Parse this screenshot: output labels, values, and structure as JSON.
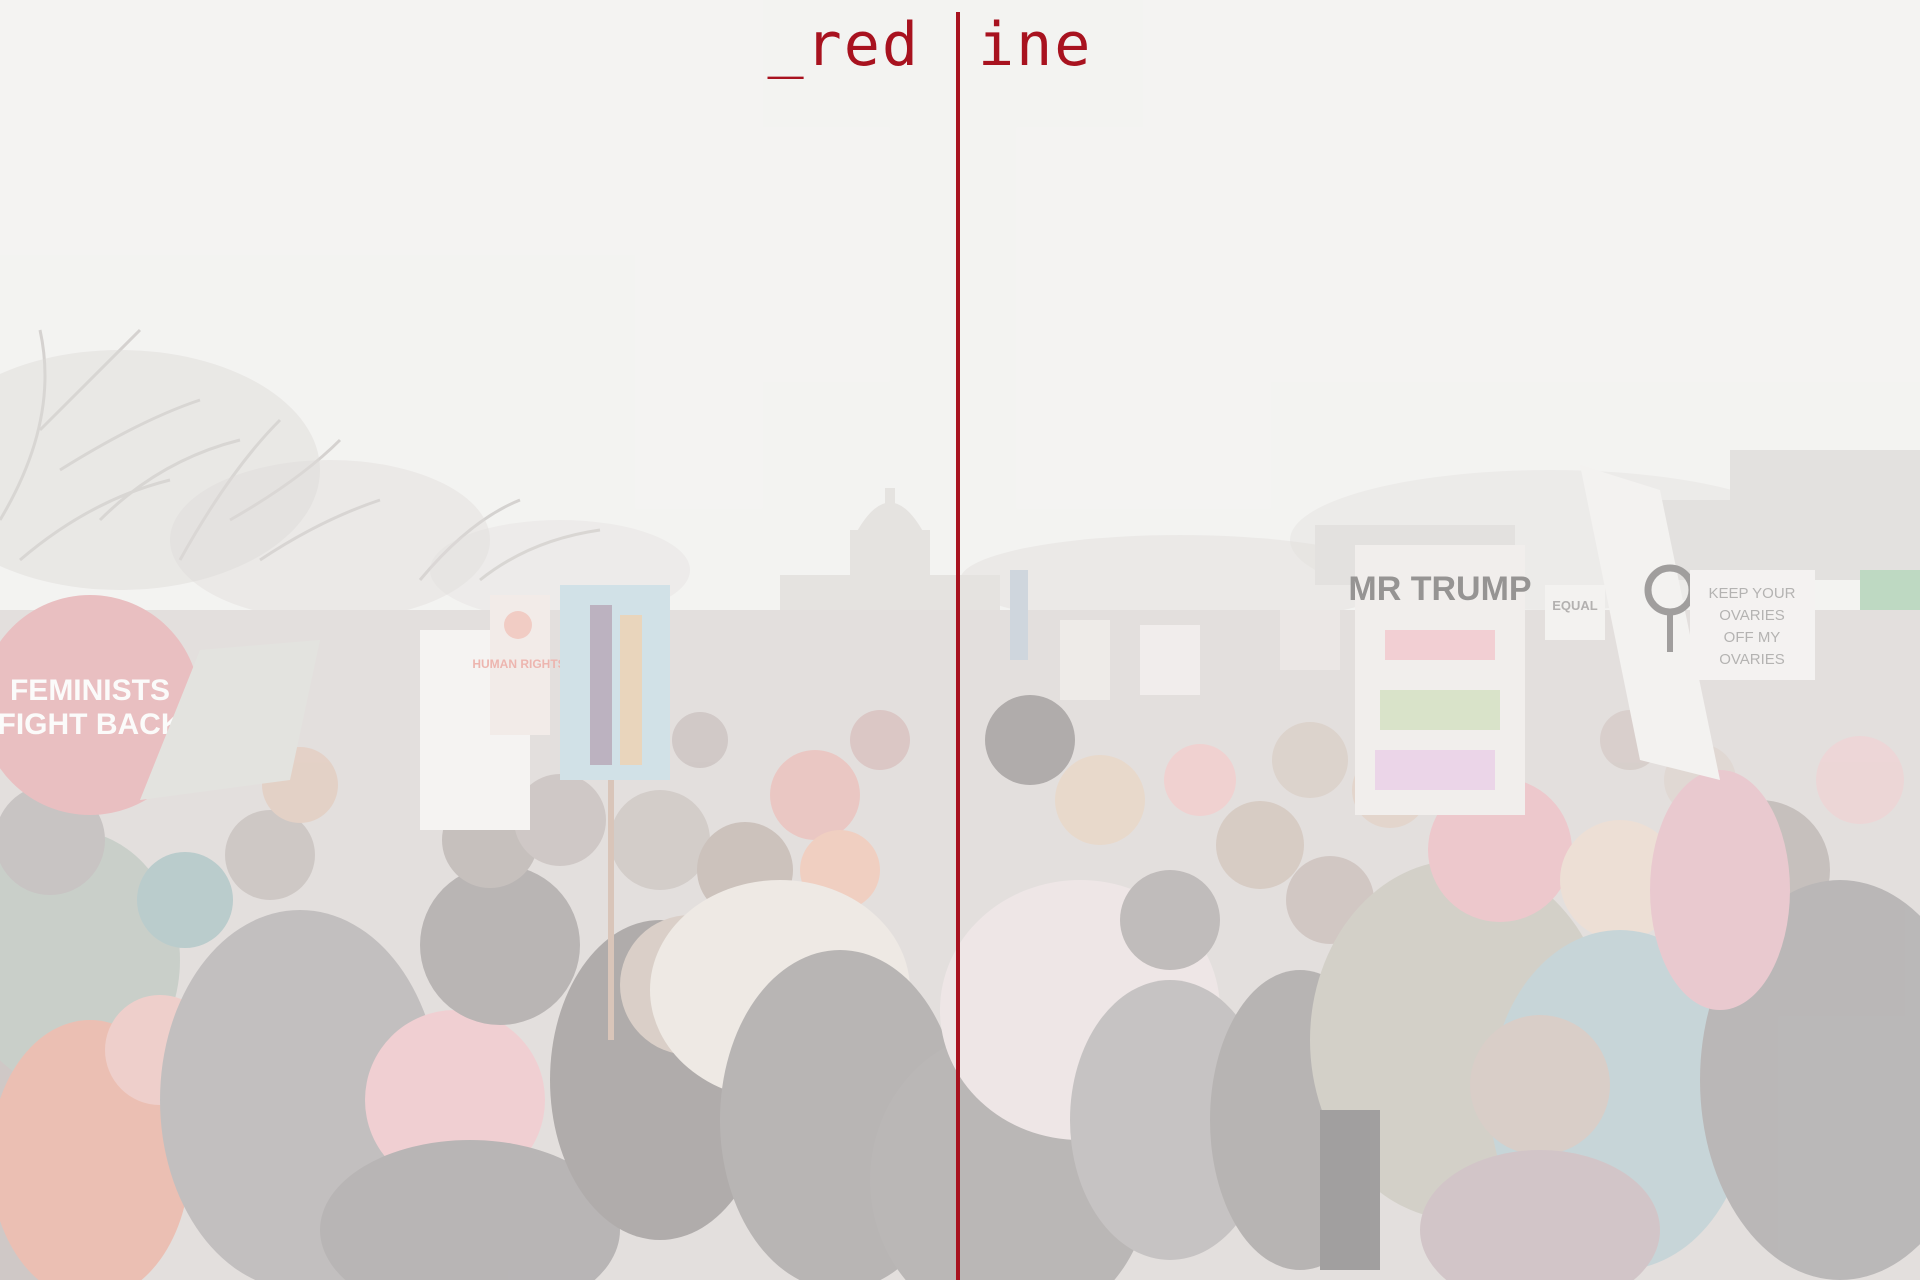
{
  "logo": {
    "left_part": "_red",
    "right_part": "ine",
    "color": "#a8121f"
  },
  "photo": {
    "signs": {
      "feminists_line1": "FEMINISTS",
      "feminists_line2": "FIGHT BACK",
      "mr_trump": "MR TRUMP",
      "human_rights": "HUMAN RIGHTS",
      "keep_line1": "KEEP YOUR",
      "keep_line2": "OVARIES",
      "keep_line3": "OFF MY",
      "keep_line4": "OVARIES",
      "equal": "EQUAL"
    }
  }
}
